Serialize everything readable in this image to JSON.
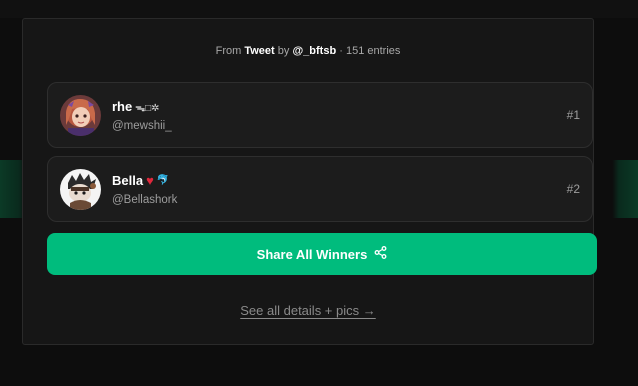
{
  "header": {
    "prefix": "From",
    "source_type": "Tweet",
    "by": "by",
    "author": "@_bftsb",
    "entries": "· 151 entries"
  },
  "winners": [
    {
      "name": "rhe",
      "decoration": "ᯓ□✲",
      "handle": "@mewshii_",
      "rank": "#1",
      "avatar_icon": "anime-girl-avatar"
    },
    {
      "name": "Bella",
      "decoration_heart": "♥",
      "decoration_extra": "🐬",
      "handle": "@Bellashork",
      "rank": "#2",
      "avatar_icon": "cartoon-character-avatar"
    }
  ],
  "share_button": {
    "label": "Share All Winners",
    "icon": "share-icon"
  },
  "details_link": {
    "label": "See all details + pics →"
  },
  "colors": {
    "accent": "#00bc7d",
    "card": "#161616",
    "row": "#1c1c1c",
    "background": "#0d0d0d"
  }
}
